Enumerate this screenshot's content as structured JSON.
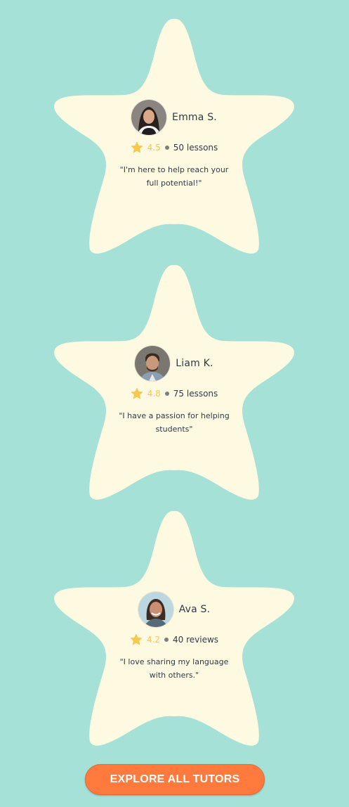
{
  "tutors": [
    {
      "name": "Emma S.",
      "rating": "4.5",
      "count_label": "50 lessons",
      "quote": "\"I'm here to help reach your full potential!\""
    },
    {
      "name": "Liam K.",
      "rating": "4.8",
      "count_label": "75 lessons",
      "quote": "\"I have a passion for helping students\""
    },
    {
      "name": "Ava S.",
      "rating": "4.2",
      "count_label": "40 reviews",
      "quote": "\"I love sharing my language with others.\""
    }
  ],
  "cta": {
    "label": "EXPLORE ALL TUTORS"
  },
  "colors": {
    "background": "#a6e1d8",
    "star_card": "#fef9e1",
    "rating": "#f6c84d",
    "cta": "#ff7a3c"
  }
}
